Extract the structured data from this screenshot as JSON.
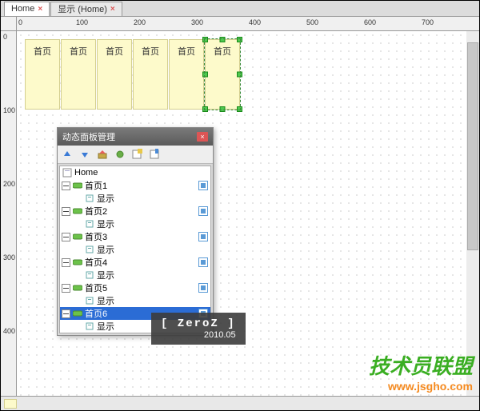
{
  "tabs": [
    {
      "label": "Home",
      "sub": ""
    },
    {
      "label": "显示 (Home)",
      "sub": ""
    }
  ],
  "ruler_h": [
    "0",
    "100",
    "200",
    "300",
    "400",
    "500",
    "600",
    "700"
  ],
  "ruler_v": [
    "0",
    "100",
    "200",
    "300",
    "400"
  ],
  "widgets": [
    "首页",
    "首页",
    "首页",
    "首页",
    "首页",
    "首页"
  ],
  "selected_index": 5,
  "panel": {
    "title": "动态面板管理",
    "tree": {
      "root": "Home",
      "items": [
        {
          "name": "首页1",
          "child": "显示"
        },
        {
          "name": "首页2",
          "child": "显示"
        },
        {
          "name": "首页3",
          "child": "显示"
        },
        {
          "name": "首页4",
          "child": "显示"
        },
        {
          "name": "首页5",
          "child": "显示"
        },
        {
          "name": "首页6",
          "child": "显示",
          "selected": true
        }
      ]
    }
  },
  "overlay": {
    "line1": "[ ZeroZ ]",
    "line2": "2010.05"
  },
  "watermark": {
    "line1": "技术员联盟",
    "line2": "www.jsgho.com"
  }
}
